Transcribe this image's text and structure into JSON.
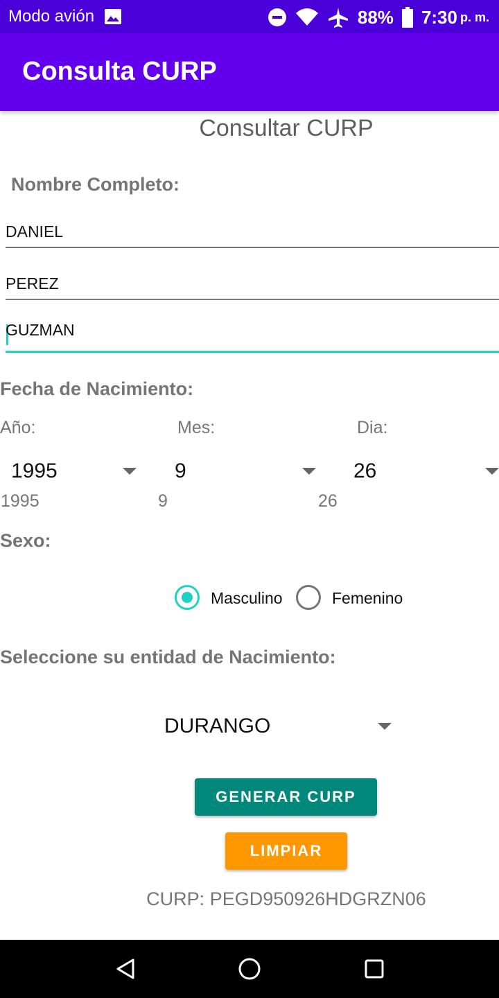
{
  "status_bar": {
    "left_text": "Modo avión",
    "battery": "88%",
    "time": "7:30",
    "ampm": "p. m.",
    "icons": [
      "image-icon",
      "do-not-disturb-icon",
      "wifi-icon",
      "airplane-icon",
      "battery-icon"
    ]
  },
  "app_bar": {
    "title": "Consulta CURP"
  },
  "form": {
    "heading": "Consultar CURP",
    "name_label": "Nombre Completo:",
    "first_name": "DANIEL",
    "last_name_1": "PEREZ",
    "last_name_2": "GUZMAN",
    "birth_label": "Fecha de Nacimiento:",
    "year_label": "Año:",
    "month_label": "Mes:",
    "day_label": "Dia:",
    "year_value": "1995",
    "month_value": "9",
    "day_value": "26",
    "year_echo": "1995",
    "month_echo": "9",
    "day_echo": "26",
    "sex_label": "Sexo:",
    "sex_options": [
      "Masculino",
      "Femenino"
    ],
    "sex_selected": "Masculino",
    "state_label": "Seleccione su entidad de Nacimiento:",
    "state_value": "DURANGO",
    "generate_button": "GENERAR CURP",
    "clear_button": "LIMPIAR",
    "result": "CURP: PEGD950926HDGRZN06"
  },
  "colors": {
    "status_bar": "#4a00d8",
    "app_bar": "#6200ee",
    "accent": "#1fd1c3",
    "generate_button": "#00897b",
    "clear_button": "#ff9800"
  }
}
